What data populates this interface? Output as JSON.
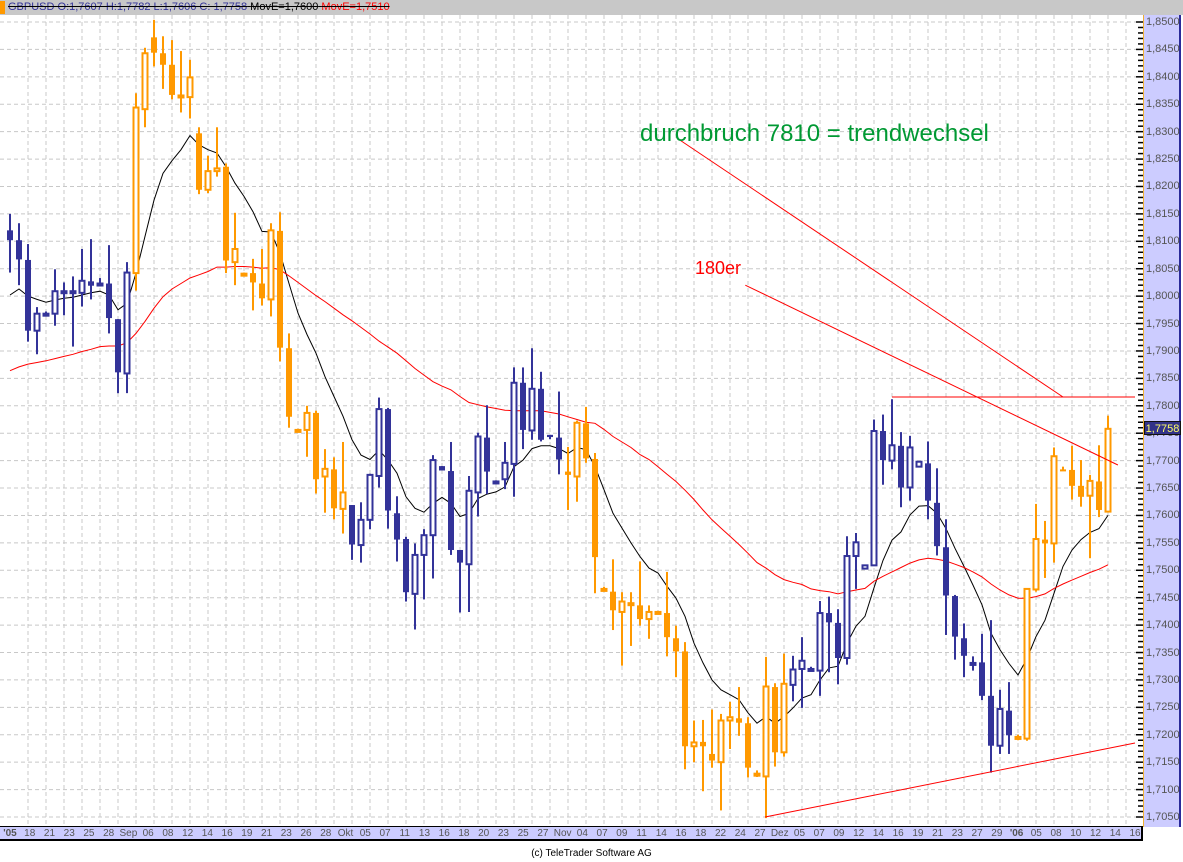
{
  "header": {
    "symbol_ohlc": "GBPUSD O:1,7607 H:1,7782 L:1,7606 C: 1,7758",
    "ma_short": "MovE=1,7600",
    "ma_long": "MovE=1,7510"
  },
  "current_price_label": "1,7758",
  "footer": "(c) TeleTrader Software AG",
  "colors": {
    "blue": "#333399",
    "orange": "#ff9900",
    "ma_short": "#000000",
    "ma_long": "#ff0000",
    "annotation_green": "#009933",
    "annotation_red": "#ff0000"
  },
  "chart_data": {
    "type": "candlestick",
    "title": "GBPUSD",
    "ylim": [
      1.705,
      1.85
    ],
    "y_ticks": [
      "1,8500",
      "1,8450",
      "1,8400",
      "1,8350",
      "1,8300",
      "1,8250",
      "1,8200",
      "1,8150",
      "1,8100",
      "1,8050",
      "1,8000",
      "1,7950",
      "1,7900",
      "1,7850",
      "1,7800",
      "1,7750",
      "1,7700",
      "1,7650",
      "1,7600",
      "1,7550",
      "1,7500",
      "1,7450",
      "1,7400",
      "1,7350",
      "1,7300",
      "1,7250",
      "1,7200",
      "1,7150",
      "1,7100",
      "1,7050"
    ],
    "x_ticks": [
      "'05",
      "18",
      "21",
      "23",
      "25",
      "28",
      "Sep",
      "06",
      "08",
      "12",
      "14",
      "16",
      "19",
      "21",
      "23",
      "26",
      "28",
      "Okt",
      "05",
      "07",
      "11",
      "13",
      "16",
      "18",
      "20",
      "23",
      "25",
      "27",
      "Nov",
      "04",
      "07",
      "09",
      "11",
      "14",
      "16",
      "18",
      "22",
      "24",
      "27",
      "Dez",
      "05",
      "07",
      "09",
      "12",
      "14",
      "16",
      "19",
      "21",
      "23",
      "27",
      "29",
      "'06",
      "05",
      "08",
      "10",
      "12",
      "14",
      "16"
    ],
    "grid": true,
    "candle_fields": [
      "open",
      "high",
      "low",
      "close",
      "color"
    ],
    "candles": [
      [
        1.812,
        1.815,
        1.8043,
        1.8102,
        "b"
      ],
      [
        1.8102,
        1.8133,
        1.802,
        1.8067,
        "b"
      ],
      [
        1.8066,
        1.8095,
        1.7917,
        1.7937,
        "b"
      ],
      [
        1.7937,
        1.798,
        1.7894,
        1.7968,
        "b"
      ],
      [
        1.7968,
        1.7972,
        1.7965,
        1.7968,
        "b"
      ],
      [
        1.7968,
        1.8049,
        1.7946,
        1.8009,
        "b"
      ],
      [
        1.8009,
        1.8025,
        1.7965,
        1.8009,
        "b"
      ],
      [
        1.8009,
        1.8036,
        1.7908,
        1.8009,
        "b"
      ],
      [
        1.8006,
        1.8086,
        1.7981,
        1.8028,
        "b"
      ],
      [
        1.8027,
        1.8104,
        1.7994,
        1.8019,
        "b"
      ],
      [
        1.8023,
        1.8033,
        1.802,
        1.8023,
        "b"
      ],
      [
        1.8023,
        1.8093,
        1.7932,
        1.796,
        "b"
      ],
      [
        1.7958,
        1.7958,
        1.7823,
        1.7861,
        "b"
      ],
      [
        1.7859,
        1.8062,
        1.7823,
        1.8043,
        "b"
      ],
      [
        1.8042,
        1.837,
        1.801,
        1.8344,
        "o"
      ],
      [
        1.8341,
        1.8453,
        1.8308,
        1.8443,
        "o"
      ],
      [
        1.8472,
        1.8504,
        1.8419,
        1.8444,
        "o"
      ],
      [
        1.8443,
        1.8474,
        1.8378,
        1.8422,
        "o"
      ],
      [
        1.8422,
        1.8467,
        1.8359,
        1.8367,
        "o"
      ],
      [
        1.8366,
        1.8447,
        1.8335,
        1.8366,
        "o"
      ],
      [
        1.8363,
        1.8431,
        1.8324,
        1.8399,
        "o"
      ],
      [
        1.8297,
        1.8308,
        1.8186,
        1.8194,
        "o"
      ],
      [
        1.8194,
        1.8256,
        1.8188,
        1.8228,
        "o"
      ],
      [
        1.8228,
        1.8308,
        1.8218,
        1.8233,
        "o"
      ],
      [
        1.8236,
        1.8242,
        1.8042,
        1.8065,
        "o"
      ],
      [
        1.8062,
        1.8152,
        1.802,
        1.8086,
        "o"
      ],
      [
        1.8041,
        1.8043,
        1.8039,
        1.8041,
        "o"
      ],
      [
        1.8042,
        1.8068,
        1.7974,
        1.8025,
        "o"
      ],
      [
        1.8023,
        1.8086,
        1.7983,
        1.7996,
        "o"
      ],
      [
        1.7994,
        1.8133,
        1.7963,
        1.812,
        "o"
      ],
      [
        1.8119,
        1.8153,
        1.7881,
        1.7906,
        "o"
      ],
      [
        1.7905,
        1.7932,
        1.776,
        1.778,
        "o"
      ],
      [
        1.7756,
        1.7758,
        1.7754,
        1.7756,
        "o"
      ],
      [
        1.7756,
        1.78,
        1.7707,
        1.7787,
        "o"
      ],
      [
        1.7787,
        1.7791,
        1.764,
        1.7666,
        "o"
      ],
      [
        1.7671,
        1.7721,
        1.7605,
        1.7685,
        "o"
      ],
      [
        1.7684,
        1.7706,
        1.7593,
        1.7613,
        "o"
      ],
      [
        1.7612,
        1.7734,
        1.7567,
        1.7642,
        "o"
      ],
      [
        1.7619,
        1.7619,
        1.7519,
        1.7547,
        "b"
      ],
      [
        1.7546,
        1.7624,
        1.7514,
        1.7592,
        "b"
      ],
      [
        1.7592,
        1.7676,
        1.7575,
        1.7674,
        "b"
      ],
      [
        1.7672,
        1.7815,
        1.7651,
        1.7794,
        "b"
      ],
      [
        1.7794,
        1.7796,
        1.7576,
        1.7609,
        "b"
      ],
      [
        1.7604,
        1.7635,
        1.7516,
        1.7556,
        "b"
      ],
      [
        1.7557,
        1.7561,
        1.7443,
        1.746,
        "b"
      ],
      [
        1.7457,
        1.7549,
        1.7392,
        1.7528,
        "b"
      ],
      [
        1.7528,
        1.7575,
        1.7447,
        1.7564,
        "b"
      ],
      [
        1.7564,
        1.771,
        1.7485,
        1.7701,
        "b"
      ],
      [
        1.769,
        1.769,
        1.7682,
        1.7682,
        "b"
      ],
      [
        1.7681,
        1.7734,
        1.7528,
        1.7537,
        "b"
      ],
      [
        1.7537,
        1.7537,
        1.7423,
        1.7514,
        "b"
      ],
      [
        1.7511,
        1.7672,
        1.7424,
        1.7645,
        "b"
      ],
      [
        1.7642,
        1.7751,
        1.7598,
        1.7744,
        "b"
      ],
      [
        1.7742,
        1.7801,
        1.7639,
        1.768,
        "b"
      ],
      [
        1.7662,
        1.7664,
        1.766,
        1.7662,
        "b"
      ],
      [
        1.7666,
        1.7734,
        1.7648,
        1.7696,
        "b"
      ],
      [
        1.7694,
        1.787,
        1.7634,
        1.7842,
        "b"
      ],
      [
        1.7842,
        1.787,
        1.7721,
        1.7756,
        "b"
      ],
      [
        1.7755,
        1.7905,
        1.7738,
        1.7831,
        "b"
      ],
      [
        1.7831,
        1.7862,
        1.7735,
        1.7738,
        "b"
      ],
      [
        1.7747,
        1.7747,
        1.7739,
        1.7743,
        "b"
      ],
      [
        1.7742,
        1.7826,
        1.7675,
        1.7702,
        "b"
      ],
      [
        1.768,
        1.7725,
        1.761,
        1.7674,
        "o"
      ],
      [
        1.7671,
        1.7773,
        1.7625,
        1.7769,
        "o"
      ],
      [
        1.7768,
        1.7798,
        1.7696,
        1.7704,
        "o"
      ],
      [
        1.7703,
        1.7714,
        1.7458,
        1.7524,
        "o"
      ],
      [
        1.7466,
        1.747,
        1.7462,
        1.7466,
        "o"
      ],
      [
        1.7461,
        1.752,
        1.7391,
        1.7427,
        "o"
      ],
      [
        1.7424,
        1.746,
        1.7326,
        1.7443,
        "o"
      ],
      [
        1.744,
        1.746,
        1.7362,
        1.744,
        "o"
      ],
      [
        1.7436,
        1.7516,
        1.7399,
        1.7411,
        "o"
      ],
      [
        1.7411,
        1.7436,
        1.7375,
        1.7424,
        "o"
      ],
      [
        1.7424,
        1.7426,
        1.7422,
        1.7424,
        "o"
      ],
      [
        1.7422,
        1.7497,
        1.7343,
        1.7378,
        "o"
      ],
      [
        1.7376,
        1.7399,
        1.7305,
        1.7352,
        "o"
      ],
      [
        1.7352,
        1.7369,
        1.7137,
        1.7179,
        "o"
      ],
      [
        1.7179,
        1.7226,
        1.715,
        1.7186,
        "o"
      ],
      [
        1.7187,
        1.7227,
        1.7097,
        1.7179,
        "o"
      ],
      [
        1.7165,
        1.7246,
        1.714,
        1.7153,
        "o"
      ],
      [
        1.715,
        1.7238,
        1.7062,
        1.7226,
        "o"
      ],
      [
        1.7226,
        1.726,
        1.7174,
        1.7232,
        "o"
      ],
      [
        1.723,
        1.7287,
        1.7198,
        1.7222,
        "o"
      ],
      [
        1.7221,
        1.7232,
        1.7122,
        1.714,
        "o"
      ],
      [
        1.7129,
        1.7135,
        1.7123,
        1.7129,
        "o"
      ],
      [
        1.7124,
        1.7342,
        1.7048,
        1.7288,
        "o"
      ],
      [
        1.7287,
        1.7294,
        1.7142,
        1.7168,
        "o"
      ],
      [
        1.7168,
        1.7348,
        1.716,
        1.7293,
        "o"
      ],
      [
        1.7291,
        1.7344,
        1.7261,
        1.7319,
        "b"
      ],
      [
        1.732,
        1.7378,
        1.7249,
        1.7335,
        "b"
      ],
      [
        1.732,
        1.7324,
        1.7316,
        1.732,
        "b"
      ],
      [
        1.7317,
        1.7444,
        1.7271,
        1.7422,
        "b"
      ],
      [
        1.7422,
        1.7452,
        1.7314,
        1.7405,
        "b"
      ],
      [
        1.7404,
        1.7429,
        1.7292,
        1.734,
        "b"
      ],
      [
        1.734,
        1.7562,
        1.7328,
        1.7526,
        "b"
      ],
      [
        1.7526,
        1.7568,
        1.7466,
        1.7551,
        "b"
      ],
      [
        1.7503,
        1.751,
        1.7502,
        1.7509,
        "b"
      ],
      [
        1.7509,
        1.7775,
        1.7509,
        1.7754,
        "b"
      ],
      [
        1.7754,
        1.7784,
        1.7656,
        1.7701,
        "b"
      ],
      [
        1.77,
        1.7812,
        1.7684,
        1.7728,
        "b"
      ],
      [
        1.7727,
        1.7752,
        1.7615,
        1.7651,
        "b"
      ],
      [
        1.7651,
        1.7745,
        1.7627,
        1.7724,
        "b"
      ],
      [
        1.7689,
        1.7698,
        1.7689,
        1.7698,
        "b"
      ],
      [
        1.7695,
        1.7735,
        1.7593,
        1.7627,
        "b"
      ],
      [
        1.7623,
        1.7686,
        1.7527,
        1.7544,
        "b"
      ],
      [
        1.7542,
        1.7593,
        1.7382,
        1.7454,
        "b"
      ],
      [
        1.7453,
        1.7455,
        1.7337,
        1.7379,
        "b"
      ],
      [
        1.7376,
        1.7403,
        1.7305,
        1.7344,
        "b"
      ],
      [
        1.7331,
        1.7343,
        1.7317,
        1.7331,
        "b"
      ],
      [
        1.7332,
        1.7384,
        1.7263,
        1.7271,
        "b"
      ],
      [
        1.7271,
        1.7409,
        1.7131,
        1.718,
        "b"
      ],
      [
        1.718,
        1.7282,
        1.7165,
        1.7247,
        "b"
      ],
      [
        1.7244,
        1.7296,
        1.7165,
        1.7199,
        "b"
      ],
      [
        1.7196,
        1.72,
        1.719,
        1.7196,
        "o"
      ],
      [
        1.7193,
        1.7466,
        1.7189,
        1.7466,
        "o"
      ],
      [
        1.7465,
        1.7621,
        1.7461,
        1.7557,
        "o"
      ],
      [
        1.7556,
        1.759,
        1.7486,
        1.7549,
        "o"
      ],
      [
        1.7549,
        1.7724,
        1.7514,
        1.7708,
        "o"
      ],
      [
        1.7684,
        1.7689,
        1.7682,
        1.7682,
        "o"
      ],
      [
        1.7683,
        1.7727,
        1.7629,
        1.7654,
        "o"
      ],
      [
        1.7654,
        1.7701,
        1.7616,
        1.7634,
        "o"
      ],
      [
        1.7636,
        1.7674,
        1.7522,
        1.7663,
        "o"
      ],
      [
        1.7662,
        1.7728,
        1.7597,
        1.761,
        "o"
      ],
      [
        1.7607,
        1.7782,
        1.7606,
        1.7758,
        "o"
      ]
    ],
    "series": [
      {
        "name": "MovE short",
        "color": "#000000",
        "values": [
          1.8002,
          1.8013,
          1.8,
          1.7994,
          1.7989,
          1.7993,
          1.7996,
          1.7998,
          1.8002,
          1.8006,
          1.8009,
          1.8002,
          1.7975,
          1.7987,
          1.8042,
          1.8109,
          1.8175,
          1.8224,
          1.8247,
          1.8267,
          1.8293,
          1.8276,
          1.8267,
          1.8261,
          1.8236,
          1.8206,
          1.8182,
          1.8154,
          1.8118,
          1.8117,
          1.8078,
          1.8023,
          1.7969,
          1.793,
          1.7896,
          1.7853,
          1.7817,
          1.7781,
          1.7738,
          1.771,
          1.7702,
          1.7719,
          1.7701,
          1.7677,
          1.7634,
          1.7613,
          1.7606,
          1.7622,
          1.7633,
          1.7622,
          1.7598,
          1.7604,
          1.7631,
          1.7639,
          1.7643,
          1.7652,
          1.7689,
          1.7701,
          1.7722,
          1.7727,
          1.7727,
          1.7722,
          1.7713,
          1.7724,
          1.772,
          1.7689,
          1.7647,
          1.7604,
          1.7577,
          1.755,
          1.7525,
          1.7504,
          1.7495,
          1.7471,
          1.7449,
          1.7416,
          1.7367,
          1.7331,
          1.73,
          1.7282,
          1.7273,
          1.7264,
          1.724,
          1.7221,
          1.7233,
          1.7221,
          1.7233,
          1.7249,
          1.7267,
          1.7273,
          1.73,
          1.7322,
          1.7325,
          1.7367,
          1.7398,
          1.7416,
          1.7468,
          1.7518,
          1.7555,
          1.757,
          1.7601,
          1.7617,
          1.7618,
          1.7604,
          1.7576,
          1.754,
          1.7507,
          1.7473,
          1.7437,
          1.7385,
          1.7355,
          1.733,
          1.7309,
          1.7339,
          1.7379,
          1.7409,
          1.7458,
          1.7507,
          1.7537,
          1.7556,
          1.7569,
          1.7576,
          1.76
        ]
      },
      {
        "name": "MovE long",
        "color": "#ff0000",
        "values": [
          1.7864,
          1.7871,
          1.7876,
          1.7879,
          1.7882,
          1.7886,
          1.789,
          1.7894,
          1.7899,
          1.7903,
          1.7908,
          1.7909,
          1.7909,
          1.7915,
          1.7932,
          1.7954,
          1.7978,
          1.7999,
          1.8013,
          1.8023,
          1.8033,
          1.8039,
          1.8045,
          1.8053,
          1.8053,
          1.8054,
          1.8054,
          1.8053,
          1.8051,
          1.8052,
          1.8048,
          1.8037,
          1.8025,
          1.8013,
          1.8001,
          1.799,
          1.7978,
          1.7966,
          1.7955,
          1.7943,
          1.7931,
          1.7918,
          1.7907,
          1.7896,
          1.7882,
          1.7868,
          1.7856,
          1.7844,
          1.7836,
          1.7829,
          1.7817,
          1.7806,
          1.7802,
          1.7798,
          1.7795,
          1.7792,
          1.7791,
          1.7791,
          1.7791,
          1.7791,
          1.7788,
          1.7785,
          1.778,
          1.7775,
          1.777,
          1.7768,
          1.7757,
          1.7744,
          1.7734,
          1.7724,
          1.7711,
          1.7702,
          1.7689,
          1.7675,
          1.7662,
          1.7646,
          1.7629,
          1.761,
          1.7592,
          1.7577,
          1.7562,
          1.7547,
          1.7531,
          1.7514,
          1.7504,
          1.7492,
          1.7483,
          1.7478,
          1.7474,
          1.7466,
          1.7463,
          1.7461,
          1.7457,
          1.7461,
          1.7464,
          1.7467,
          1.748,
          1.7489,
          1.7497,
          1.7505,
          1.7513,
          1.7519,
          1.7522,
          1.752,
          1.7517,
          1.7511,
          1.7505,
          1.7497,
          1.7488,
          1.7475,
          1.7464,
          1.7455,
          1.7449,
          1.7449,
          1.7452,
          1.7457,
          1.7467,
          1.7475,
          1.7482,
          1.7489,
          1.7496,
          1.7502,
          1.751
        ]
      }
    ],
    "trendlines": [
      {
        "name": "breakout-line",
        "from": [
          75.4,
          1.8285
        ],
        "to": [
          118,
          1.7816
        ]
      },
      {
        "name": "breakout-level",
        "from": [
          99,
          1.7816
        ],
        "to": [
          126,
          1.7816
        ]
      },
      {
        "name": "180er-line",
        "from": [
          82.7,
          1.802
        ],
        "to": [
          124.1,
          1.7692
        ]
      },
      {
        "name": "support-line",
        "from": [
          84.9,
          1.705
        ],
        "to": [
          126,
          1.7185
        ]
      }
    ],
    "annotations": [
      "durchbruch 7810 = trendwechsel",
      "180er"
    ]
  }
}
